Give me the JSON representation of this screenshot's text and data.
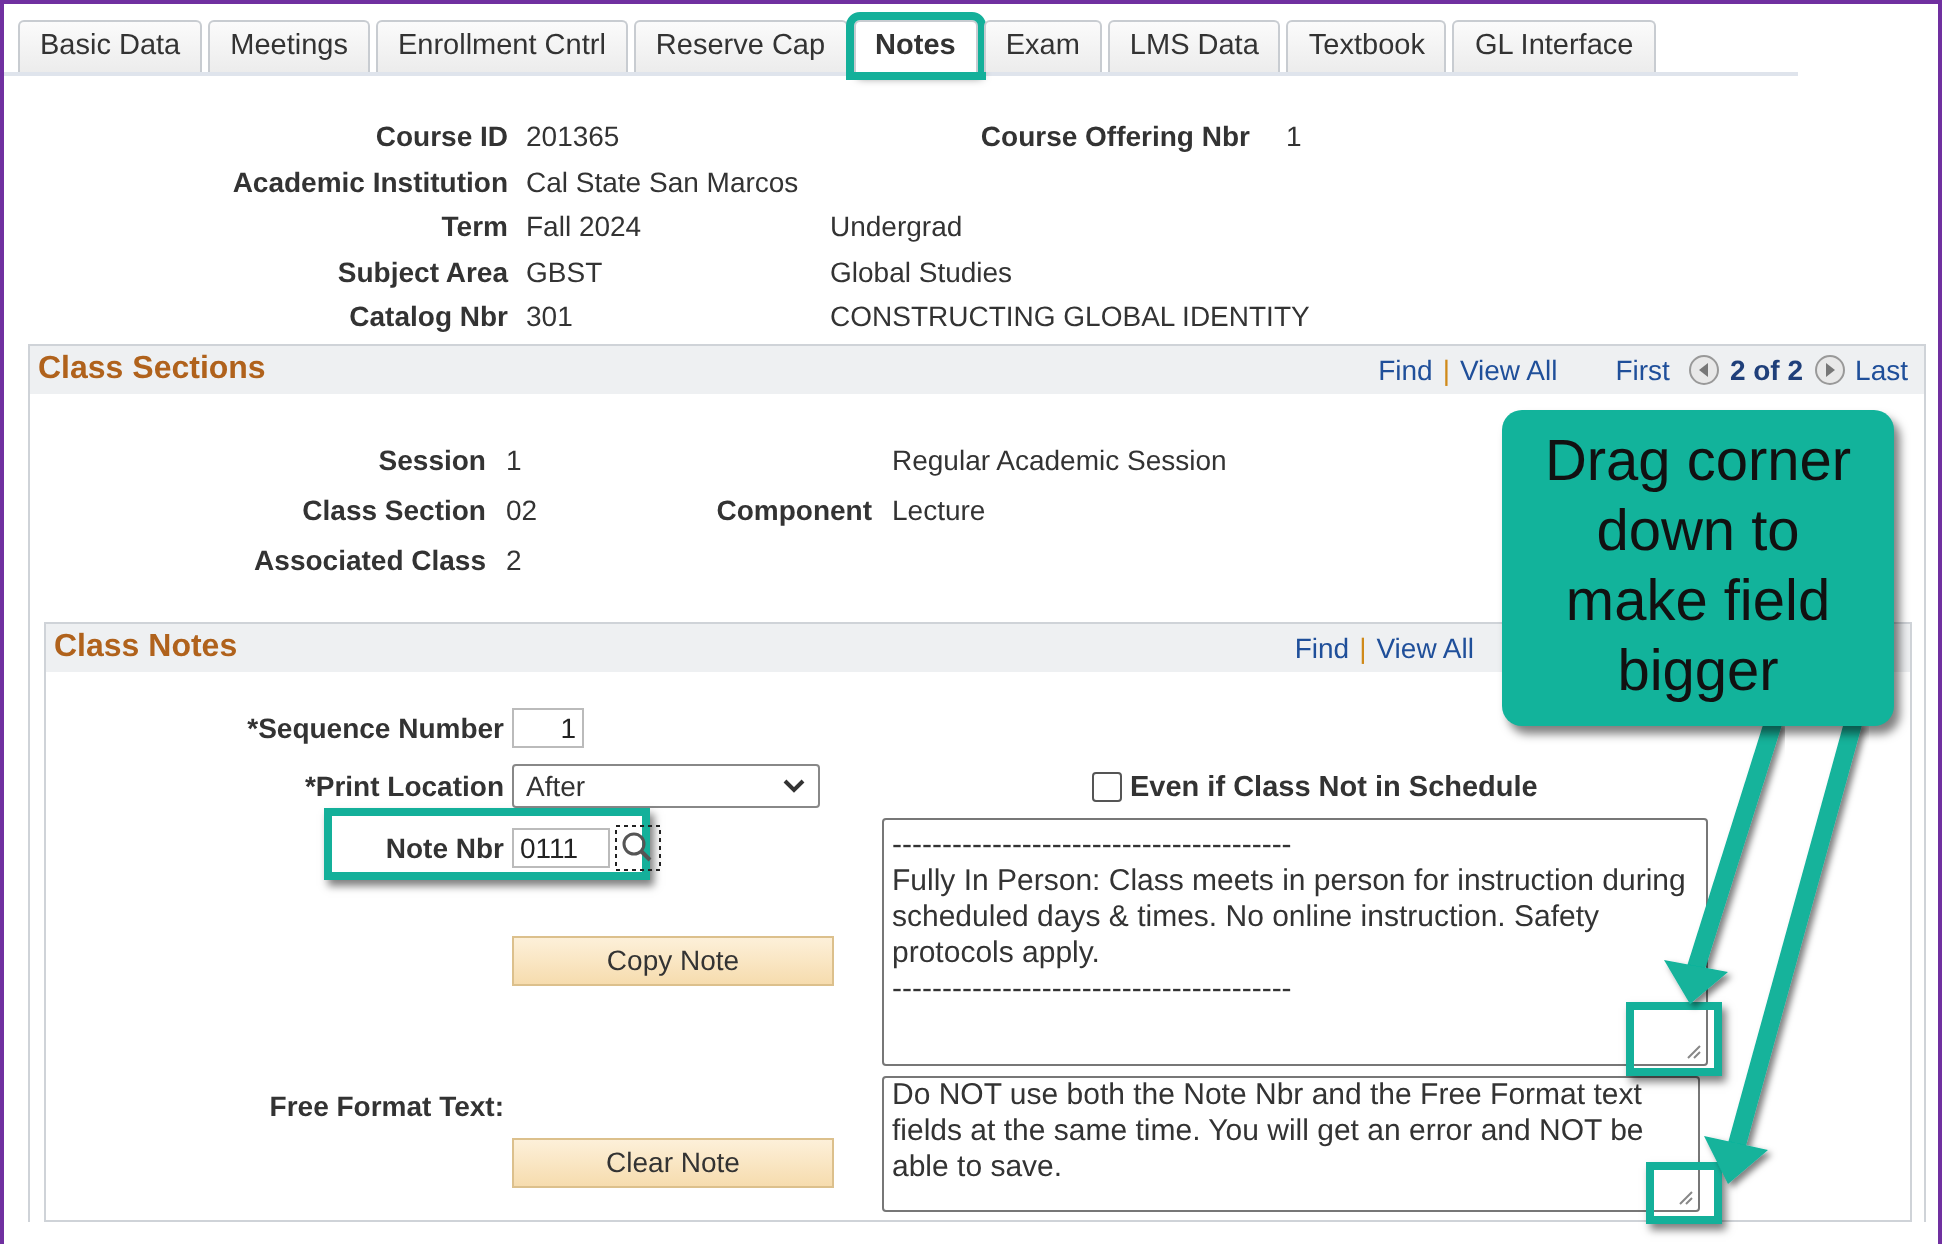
{
  "tabs": [
    {
      "label": "Basic Data",
      "selected": false
    },
    {
      "label": "Meetings",
      "selected": false
    },
    {
      "label": "Enrollment Cntrl",
      "selected": false
    },
    {
      "label": "Reserve Cap",
      "selected": false
    },
    {
      "label": "Notes",
      "selected": true,
      "highlighted": true
    },
    {
      "label": "Exam",
      "selected": false
    },
    {
      "label": "LMS Data",
      "selected": false
    },
    {
      "label": "Textbook",
      "selected": false
    },
    {
      "label": "GL Interface",
      "selected": false
    }
  ],
  "course": {
    "course_id": {
      "label": "Course ID",
      "value": "201365"
    },
    "course_offering_nbr": {
      "label": "Course Offering Nbr",
      "value": "1"
    },
    "rows": [
      {
        "label": "Academic Institution",
        "value": "Cal State San Marcos"
      },
      {
        "label": "Term",
        "value": "Fall 2024",
        "description": "Undergrad"
      },
      {
        "label": "Subject Area",
        "value": "GBST",
        "description": "Global Studies"
      },
      {
        "label": "Catalog Nbr",
        "value": "301",
        "description": "CONSTRUCTING GLOBAL IDENTITY"
      }
    ]
  },
  "class_sections": {
    "title": "Class Sections",
    "find": "Find",
    "separator": "|",
    "view_all": "View All",
    "first": "First",
    "position": "2 of 2",
    "last": "Last",
    "session": {
      "label": "Session",
      "value": "1",
      "description": "Regular Academic Session"
    },
    "class_section": {
      "label": "Class Section",
      "value": "02"
    },
    "component": {
      "label": "Component",
      "value": "Lecture"
    },
    "associated_class": {
      "label": "Associated Class",
      "value": "2"
    }
  },
  "class_notes": {
    "title": "Class Notes",
    "find": "Find",
    "separator": "|",
    "view_all": "View All",
    "sequence_number": {
      "label": "*Sequence Number",
      "value": "1"
    },
    "print_location": {
      "label": "*Print Location",
      "value": "After"
    },
    "note_nbr": {
      "label": "Note Nbr",
      "value": "0111"
    },
    "checkbox": {
      "label": "Even if Class Not in Schedule",
      "checked": false
    },
    "note_text": "----------------------------------------\nFully In Person: Class meets in person for instruction during scheduled days & times. No online instruction. Safety protocols apply.\n----------------------------------------",
    "copy_button": "Copy Note",
    "free_format_label": "Free Format Text:",
    "free_format_text": "Do NOT use both the Note Nbr and the Free Format text fields at the same time. You will get an error and NOT be able to save.",
    "clear_button": "Clear Note"
  },
  "callout": {
    "text": "Drag corner down to make field bigger"
  }
}
